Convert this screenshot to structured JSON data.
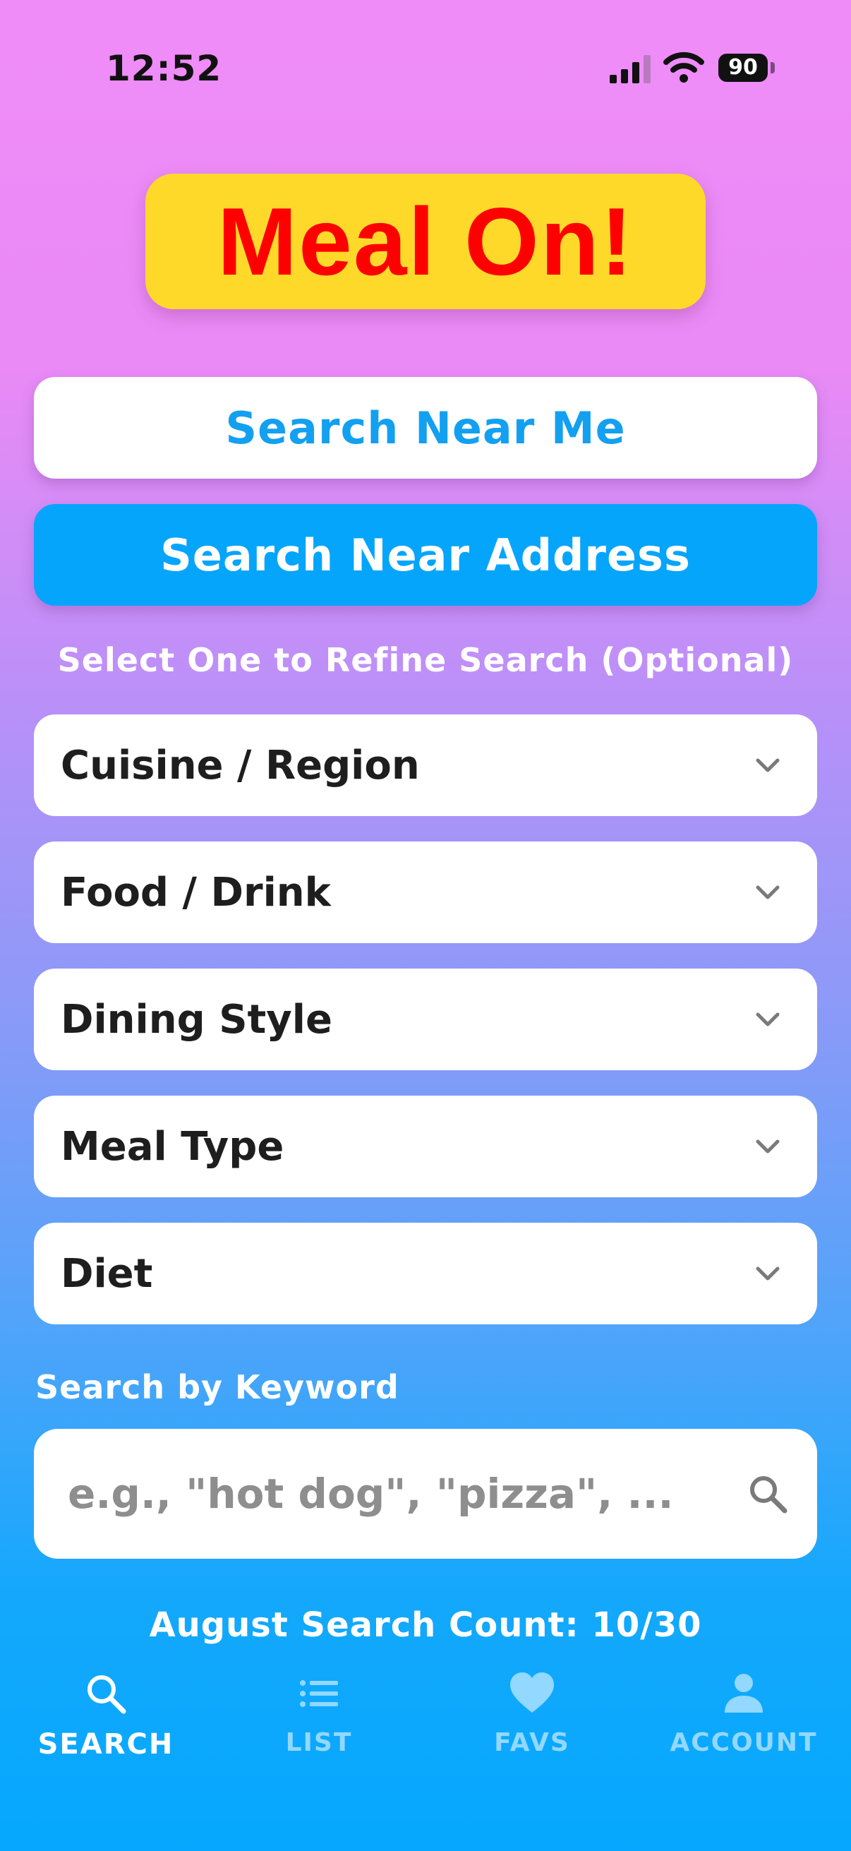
{
  "status_bar": {
    "time": "12:52",
    "battery": "90"
  },
  "logo": {
    "text": "Meal On!"
  },
  "buttons": {
    "search_near_me": "Search Near Me",
    "search_near_address": "Search Near Address"
  },
  "refine": {
    "label": "Select One to Refine Search (Optional)",
    "dropdowns": [
      {
        "label": "Cuisine / Region"
      },
      {
        "label": "Food / Drink"
      },
      {
        "label": "Dining Style"
      },
      {
        "label": "Meal Type"
      },
      {
        "label": "Diet"
      }
    ]
  },
  "keyword": {
    "label": "Search by Keyword",
    "placeholder": "e.g., \"hot dog\", \"pizza\", ..."
  },
  "search_count": "August Search Count: 10/30",
  "tabs": [
    {
      "label": "SEARCH",
      "icon": "search-icon",
      "active": true
    },
    {
      "label": "LIST",
      "icon": "list-icon",
      "active": false
    },
    {
      "label": "FAVS",
      "icon": "heart-icon",
      "active": false
    },
    {
      "label": "ACCOUNT",
      "icon": "person-icon",
      "active": false
    }
  ],
  "colors": {
    "logo_bg": "#ffd92a",
    "logo_text": "#ff0000",
    "primary_blue": "#06a5fc",
    "inactive_tab": "#92d8ff"
  }
}
